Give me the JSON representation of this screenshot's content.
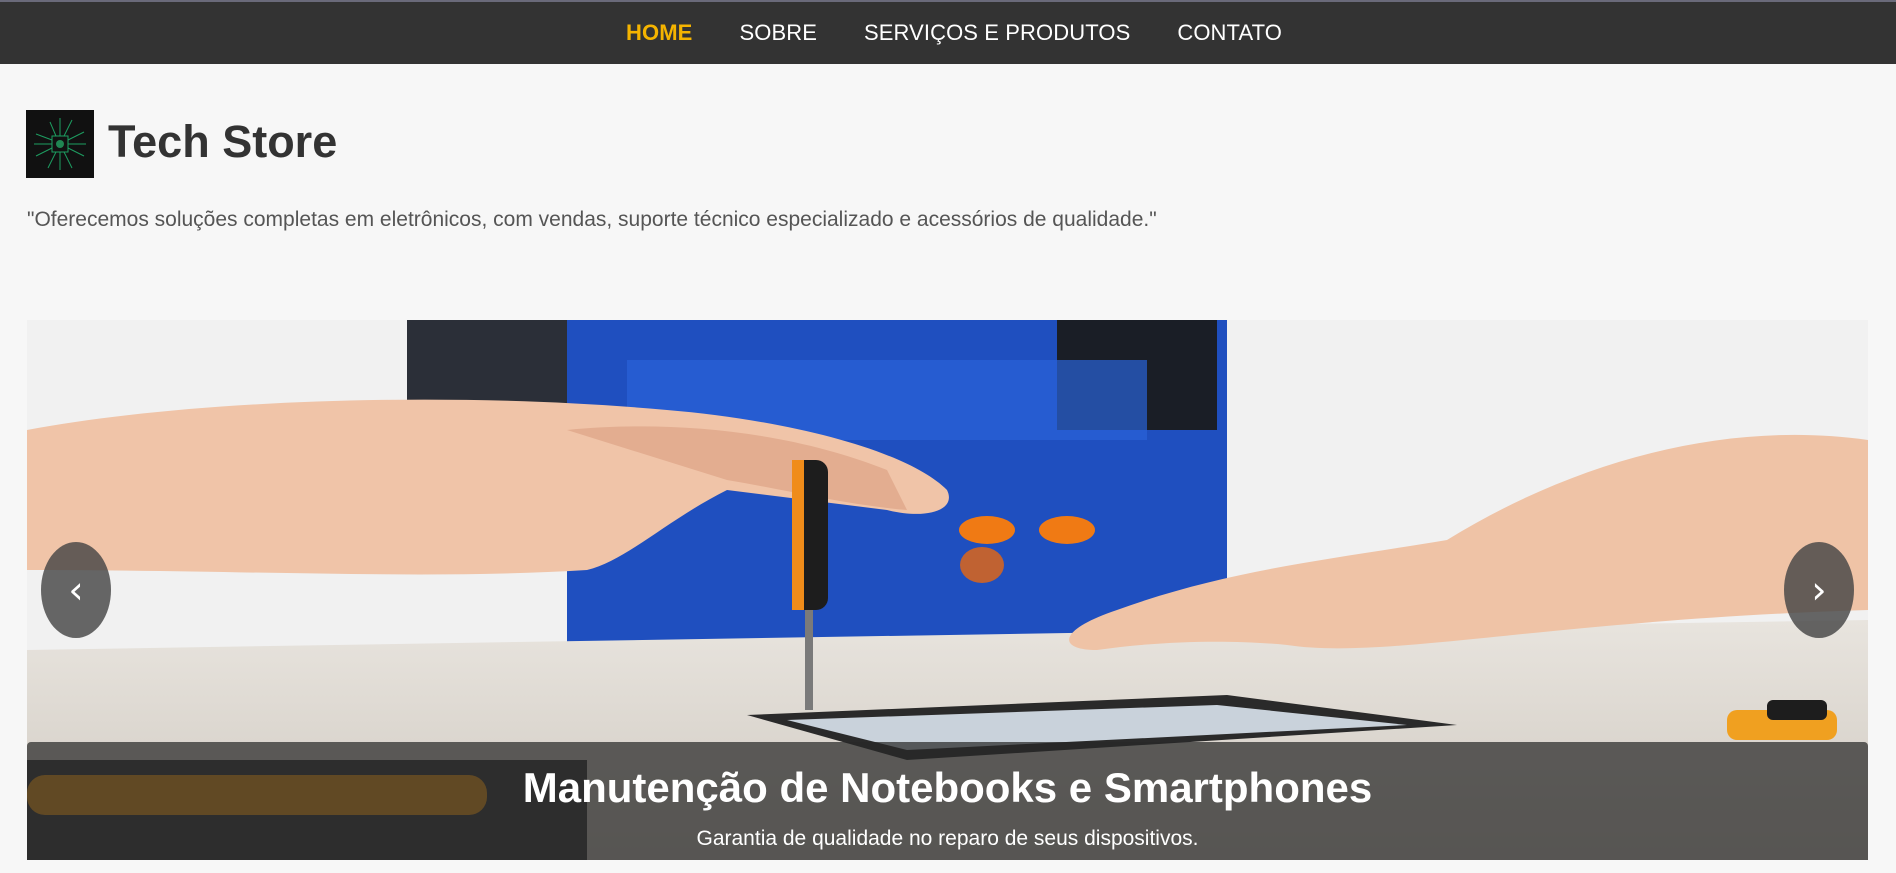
{
  "nav": {
    "items": [
      {
        "label": "HOME",
        "active": true
      },
      {
        "label": "SOBRE",
        "active": false
      },
      {
        "label": "SERVIÇOS E PRODUTOS",
        "active": false
      },
      {
        "label": "CONTATO",
        "active": false
      }
    ],
    "active_color": "#f5b400",
    "bar_color": "#333333"
  },
  "brand": {
    "name": "Tech Store",
    "logo_icon": "circuit-chip-icon"
  },
  "tagline": "\"Oferecemos soluções completas em eletrônicos, com vendas, suporte técnico especializado e acessórios de qualidade.\"",
  "slider": {
    "image": "technician-repairing-smartphone",
    "caption_title": "Manutenção de Notebooks e Smartphones",
    "caption_subtitle": "Garantia de qualidade no reparo de seus dispositivos.",
    "prev_label": "‹",
    "next_label": "›"
  }
}
